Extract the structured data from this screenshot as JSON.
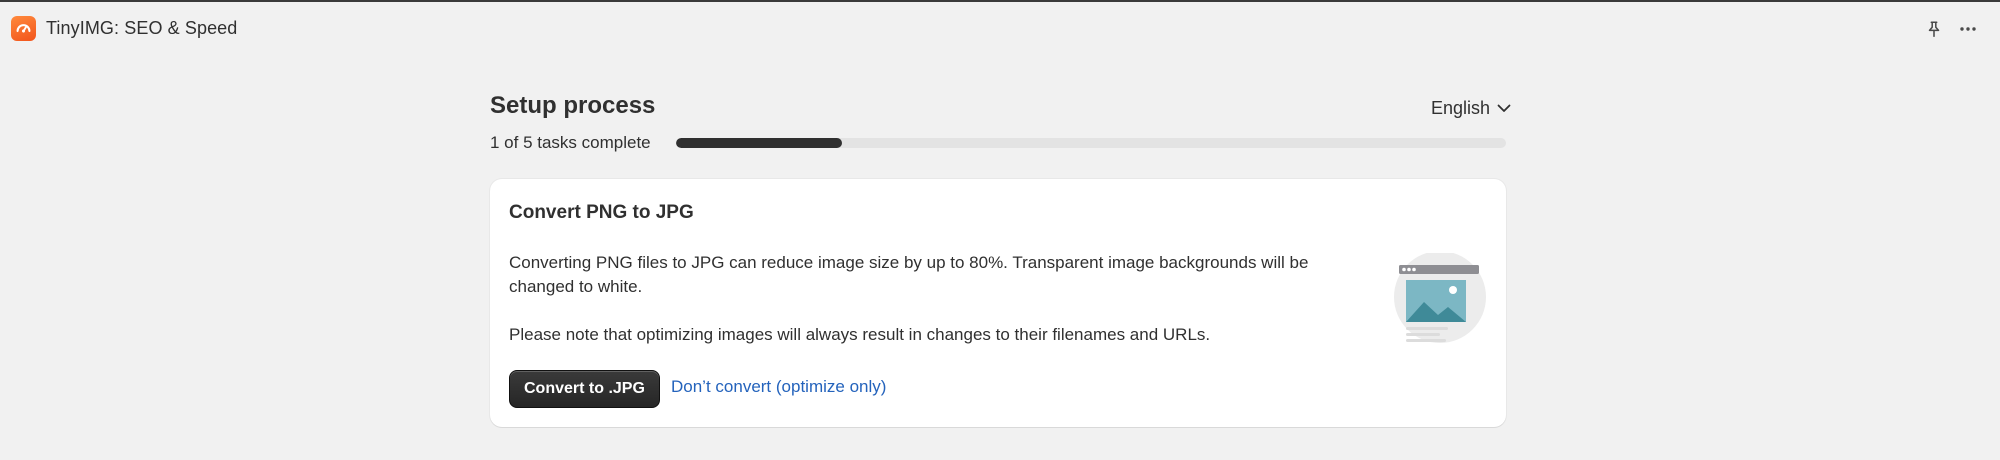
{
  "app": {
    "title": "TinyIMG: SEO & Speed",
    "logo_icon": "tinyimg-logo-icon",
    "brand_color": "#f2541b"
  },
  "header_actions": {
    "pin_icon": "pin-icon",
    "more_icon": "more-horizontal-icon"
  },
  "setup": {
    "title": "Setup process",
    "language": "English",
    "progress_text": "1 of 5 tasks complete",
    "progress_fraction": 0.2
  },
  "task": {
    "title": "Convert PNG to JPG",
    "paragraph_1": "Converting PNG files to JPG can reduce image size by up to 80%. Transparent image backgrounds will be changed to white.",
    "paragraph_2": "Please note that optimizing images will always result in changes to their filenames and URLs.",
    "primary_button": "Convert to .JPG",
    "secondary_link": "Don’t convert (optimize only)",
    "illustration_icon": "image-browser-illustration"
  },
  "colors": {
    "link": "#2463bc",
    "progress_fill": "#303030",
    "progress_track": "#e3e3e3"
  }
}
